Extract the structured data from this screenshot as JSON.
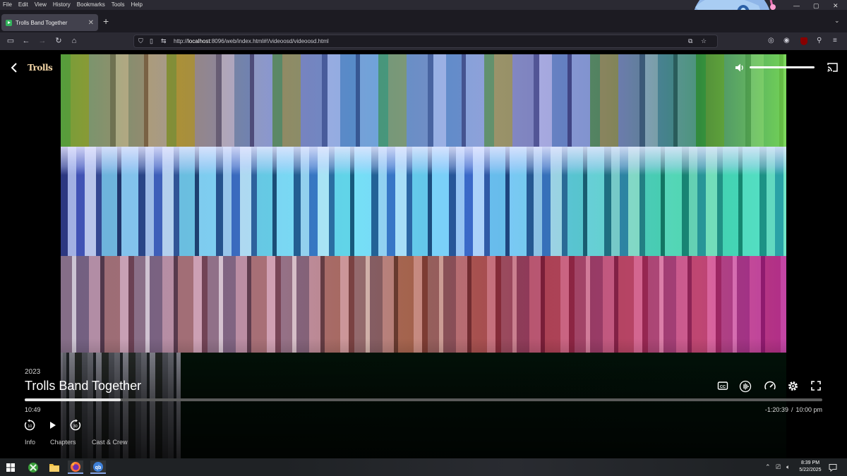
{
  "menubar": {
    "items": [
      "File",
      "Edit",
      "View",
      "History",
      "Bookmarks",
      "Tools",
      "Help"
    ]
  },
  "browser": {
    "tab_title": "Trolls Band Together",
    "new_tab_label": "+",
    "url_prefix": "http://",
    "url_host": "localhost",
    "url_rest": ":8096/web/index.html#!/videoosd/videoosd.html",
    "window_controls": {
      "minimize": "—",
      "maximize": "▢",
      "close": "✕"
    }
  },
  "player": {
    "logo_text": "Trolls",
    "year": "2023",
    "title": "Trolls Band Together",
    "elapsed": "10:49",
    "remaining": "-1:20:39",
    "separator": "/",
    "ends_at": "10:00 pm",
    "progress_fraction": 0.12,
    "volume_fraction": 1.0,
    "tabs": [
      "Info",
      "Chapters",
      "Cast & Crew"
    ],
    "icons": [
      "back-icon",
      "volume-icon",
      "cast-icon",
      "subtitles-icon",
      "audio-track-icon",
      "playback-speed-icon",
      "settings-icon",
      "fullscreen-icon",
      "rewind-icon",
      "play-icon",
      "fast-forward-icon"
    ]
  },
  "taskbar": {
    "time": "8:39 PM",
    "date": "5/22/2025",
    "apps": [
      "start-icon",
      "xbox-icon",
      "file-explorer-icon",
      "firefox-icon",
      "qbittorrent-icon"
    ]
  }
}
